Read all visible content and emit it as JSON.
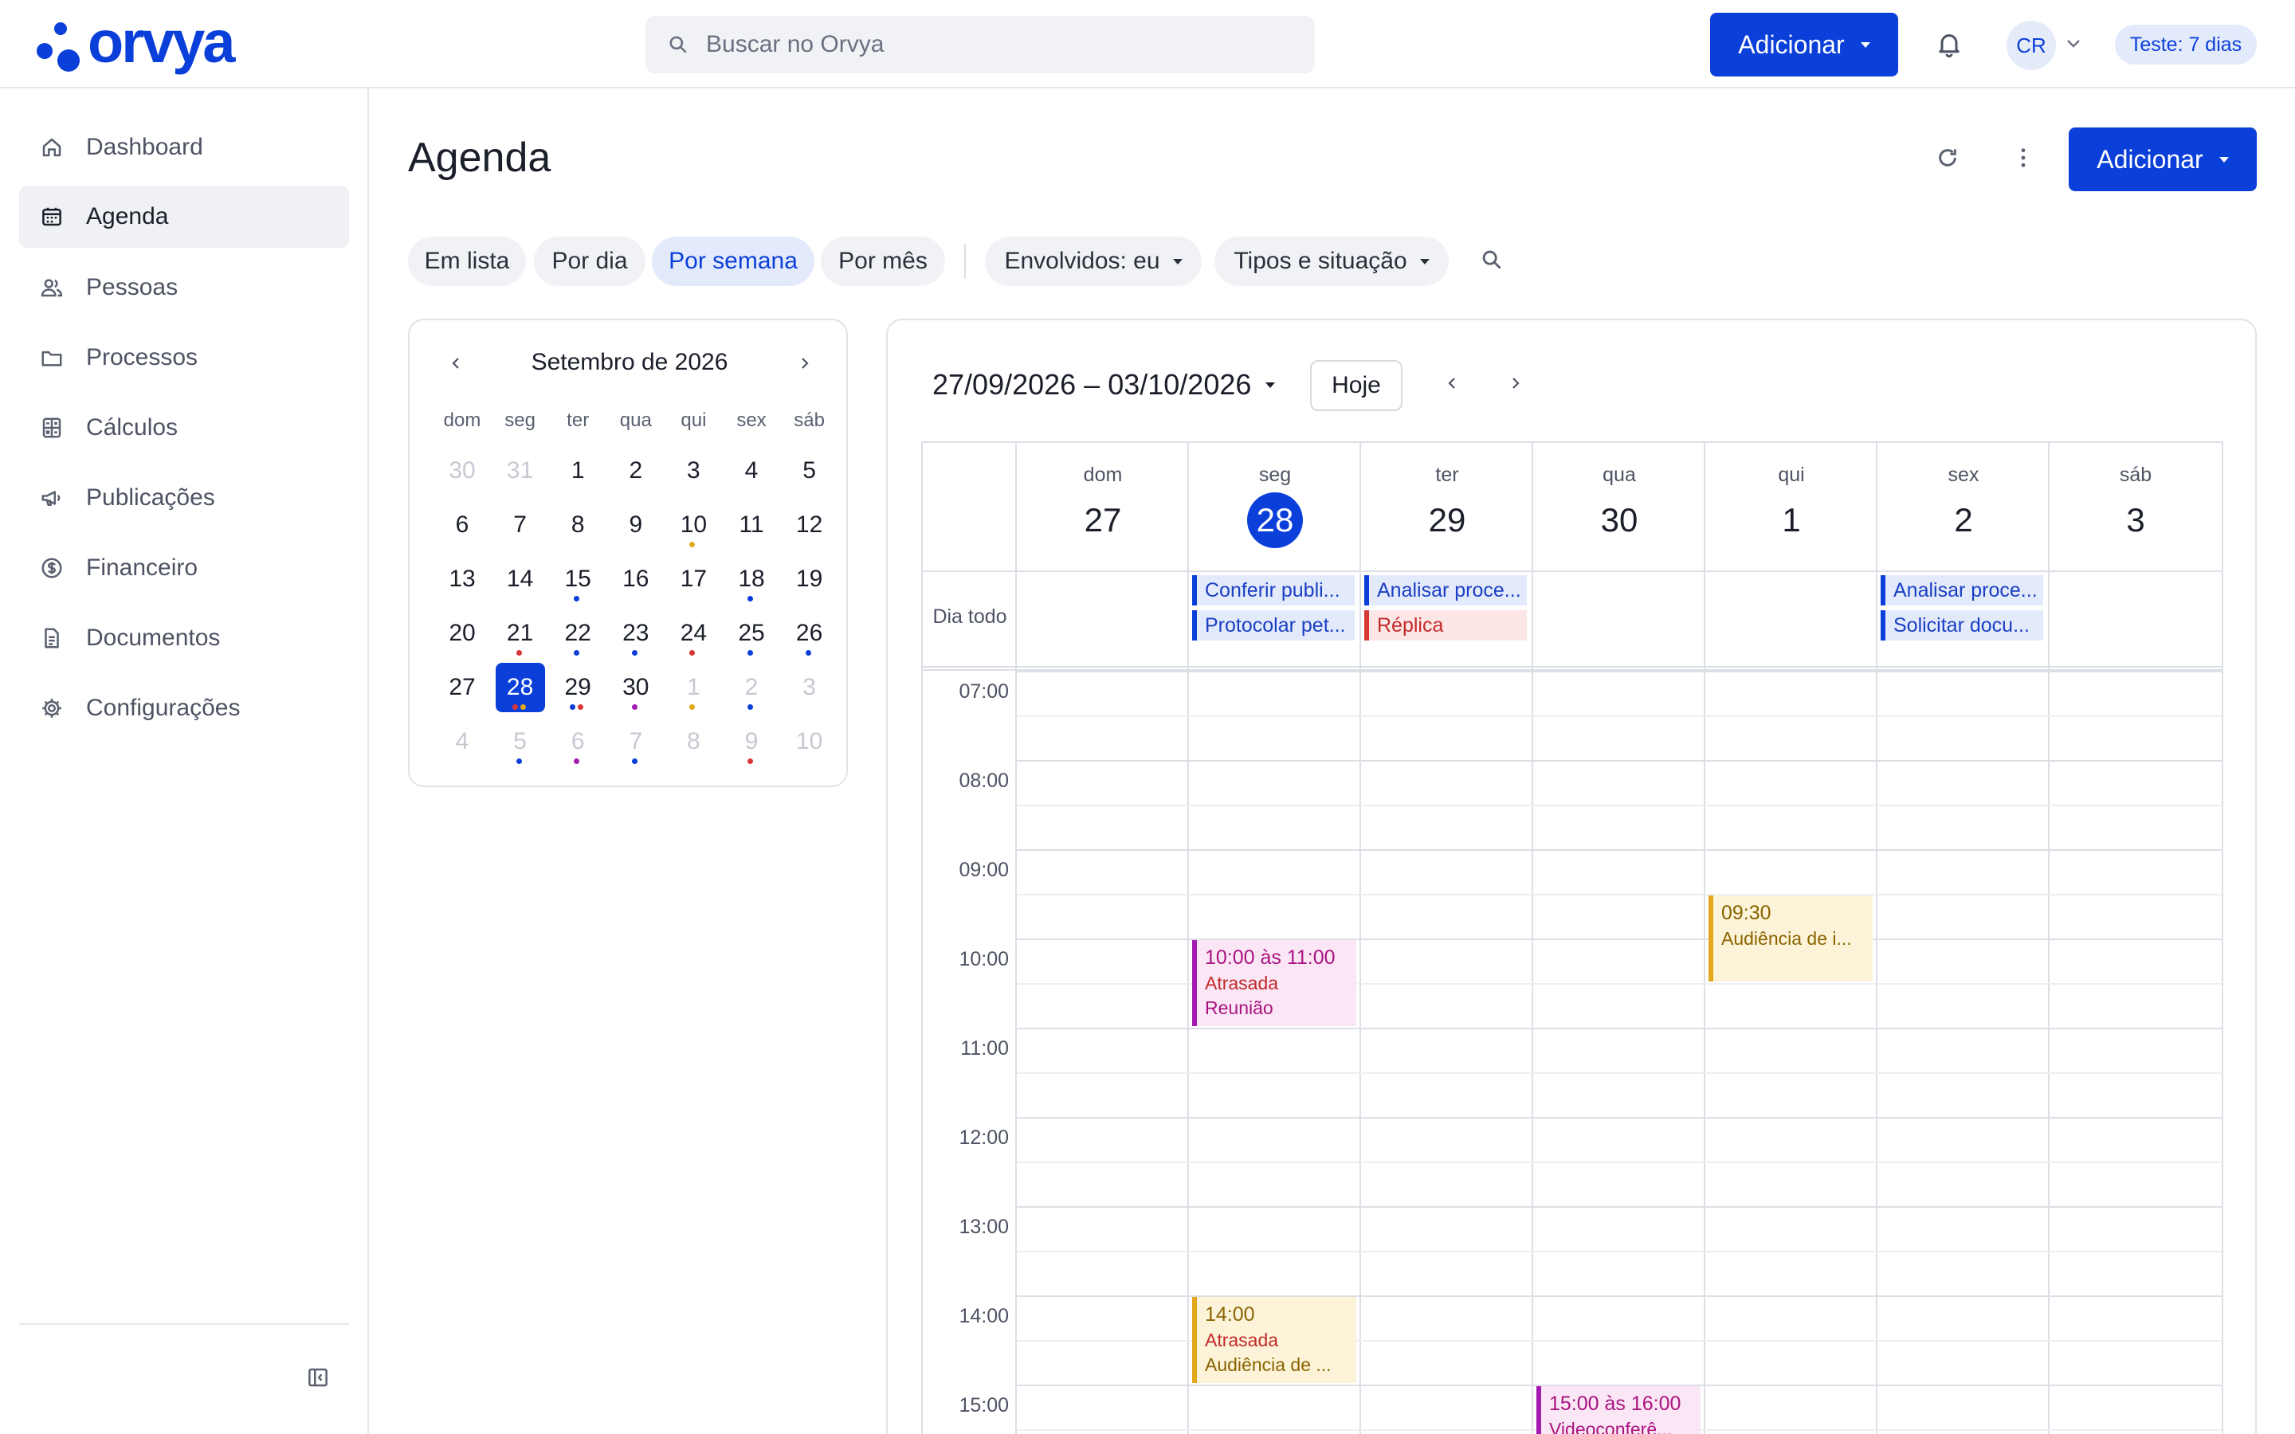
{
  "brand": {
    "name": "orvya",
    "color": "#0b3fd9"
  },
  "header": {
    "search_placeholder": "Buscar no Orvya",
    "add_label": "Adicionar",
    "avatar_initials": "CR",
    "trial_label": "Teste: 7 dias",
    "icons": [
      "search-icon",
      "caret-down-icon",
      "bell-icon",
      "chevron-down-icon"
    ]
  },
  "sidebar": {
    "items": [
      {
        "label": "Dashboard",
        "icon": "home-icon"
      },
      {
        "label": "Agenda",
        "icon": "calendar-icon",
        "active": true
      },
      {
        "label": "Pessoas",
        "icon": "people-icon"
      },
      {
        "label": "Processos",
        "icon": "folder-icon"
      },
      {
        "label": "Cálculos",
        "icon": "calculator-icon"
      },
      {
        "label": "Publicações",
        "icon": "megaphone-icon"
      },
      {
        "label": "Financeiro",
        "icon": "dollar-icon"
      },
      {
        "label": "Documentos",
        "icon": "document-icon"
      },
      {
        "label": "Configurações",
        "icon": "gear-icon"
      }
    ]
  },
  "page": {
    "title": "Agenda",
    "add_label": "Adicionar",
    "view_chips": [
      {
        "label": "Em lista"
      },
      {
        "label": "Por dia"
      },
      {
        "label": "Por semana",
        "active": true
      },
      {
        "label": "Por mês"
      }
    ],
    "filter_chips": [
      {
        "label": "Envolvidos: eu"
      },
      {
        "label": "Tipos e situação"
      }
    ]
  },
  "mini_calendar": {
    "title": "Setembro de 2026",
    "weekdays": [
      "dom",
      "seg",
      "ter",
      "qua",
      "qui",
      "sex",
      "sáb"
    ],
    "weeks": [
      [
        "30",
        "31",
        "1",
        "2",
        "3",
        "4",
        "5"
      ],
      [
        "6",
        "7",
        "8",
        "9",
        "10",
        "11",
        "12"
      ],
      [
        "13",
        "14",
        "15",
        "16",
        "17",
        "18",
        "19"
      ],
      [
        "20",
        "21",
        "22",
        "23",
        "24",
        "25",
        "26"
      ],
      [
        "27",
        "28",
        "29",
        "30",
        "1",
        "2",
        "3"
      ],
      [
        "4",
        "5",
        "6",
        "7",
        "8",
        "9",
        "10"
      ]
    ],
    "today": "28",
    "colors": {
      "blue": "#0b3fd9",
      "red": "#d93636",
      "yellow": "#e0a81a",
      "purple": "#a21caf"
    }
  },
  "week_view": {
    "range_label": "27/09/2026 – 03/10/2026",
    "today_label": "Hoje",
    "all_day_label": "Dia todo",
    "days": [
      {
        "dow": "dom",
        "num": "27"
      },
      {
        "dow": "seg",
        "num": "28",
        "today": true
      },
      {
        "dow": "ter",
        "num": "29"
      },
      {
        "dow": "qua",
        "num": "30"
      },
      {
        "dow": "qui",
        "num": "1"
      },
      {
        "dow": "sex",
        "num": "2"
      },
      {
        "dow": "sáb",
        "num": "3"
      }
    ],
    "hours": [
      "07:00",
      "08:00",
      "09:00",
      "10:00",
      "11:00",
      "12:00",
      "13:00",
      "14:00",
      "15:00"
    ],
    "all_day_events": [
      {
        "day": 1,
        "row": 0,
        "label": "Conferir publi...",
        "color": "blue"
      },
      {
        "day": 1,
        "row": 1,
        "label": "Protocolar pet...",
        "color": "blue"
      },
      {
        "day": 2,
        "row": 0,
        "label": "Analisar proce...",
        "color": "blue"
      },
      {
        "day": 2,
        "row": 1,
        "label": "Réplica",
        "color": "red"
      },
      {
        "day": 5,
        "row": 0,
        "label": "Analisar proce...",
        "color": "blue"
      },
      {
        "day": 5,
        "row": 1,
        "label": "Solicitar docu...",
        "color": "blue"
      }
    ],
    "timed_events": [
      {
        "day": 1,
        "start_hour": 10.0,
        "end_hour": 11.0,
        "time": "10:00 às 11:00",
        "status": "Atrasada",
        "title": "Reunião",
        "color": "purple"
      },
      {
        "day": 4,
        "start_hour": 9.5,
        "end_hour": 10.5,
        "time": "09:30",
        "status": "",
        "title": "Audiência de i...",
        "color": "yellow"
      },
      {
        "day": 1,
        "start_hour": 14.0,
        "end_hour": 15.0,
        "time": "14:00",
        "status": "Atrasada",
        "title": "Audiência de ...",
        "color": "yellow"
      },
      {
        "day": 3,
        "start_hour": 15.0,
        "end_hour": 16.0,
        "time": "15:00 às 16:00",
        "status": "",
        "title": "Videoconferê...",
        "color": "purple"
      }
    ]
  }
}
